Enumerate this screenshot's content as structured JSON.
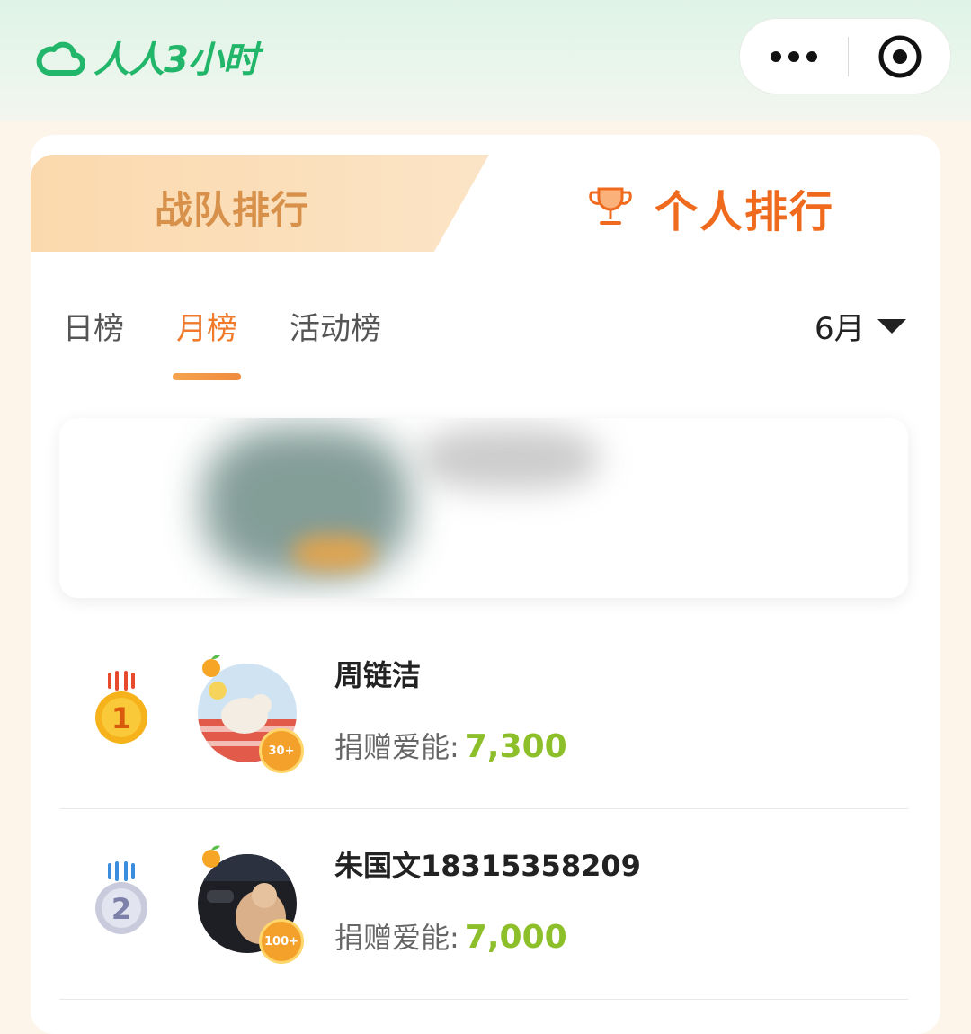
{
  "app": {
    "logo_text": "人人3小时"
  },
  "tabs": {
    "team_label": "战队排行",
    "personal_label": "个人排行"
  },
  "subtabs": [
    "日榜",
    "月榜",
    "活动榜"
  ],
  "active_subtab": "月榜",
  "month_selector": {
    "value": "6月"
  },
  "ranking": [
    {
      "rank": "1",
      "name": "周链洁",
      "score_label": "捐赠爱能:",
      "score": "7,300",
      "badge": "30+"
    },
    {
      "rank": "2",
      "name": "朱国文18315358209",
      "score_label": "捐赠爱能:",
      "score": "7,000",
      "badge": "100+"
    }
  ],
  "colors": {
    "brand_green": "#22b66a",
    "accent_orange": "#f06a1e",
    "score_green": "#8cbf2a"
  }
}
